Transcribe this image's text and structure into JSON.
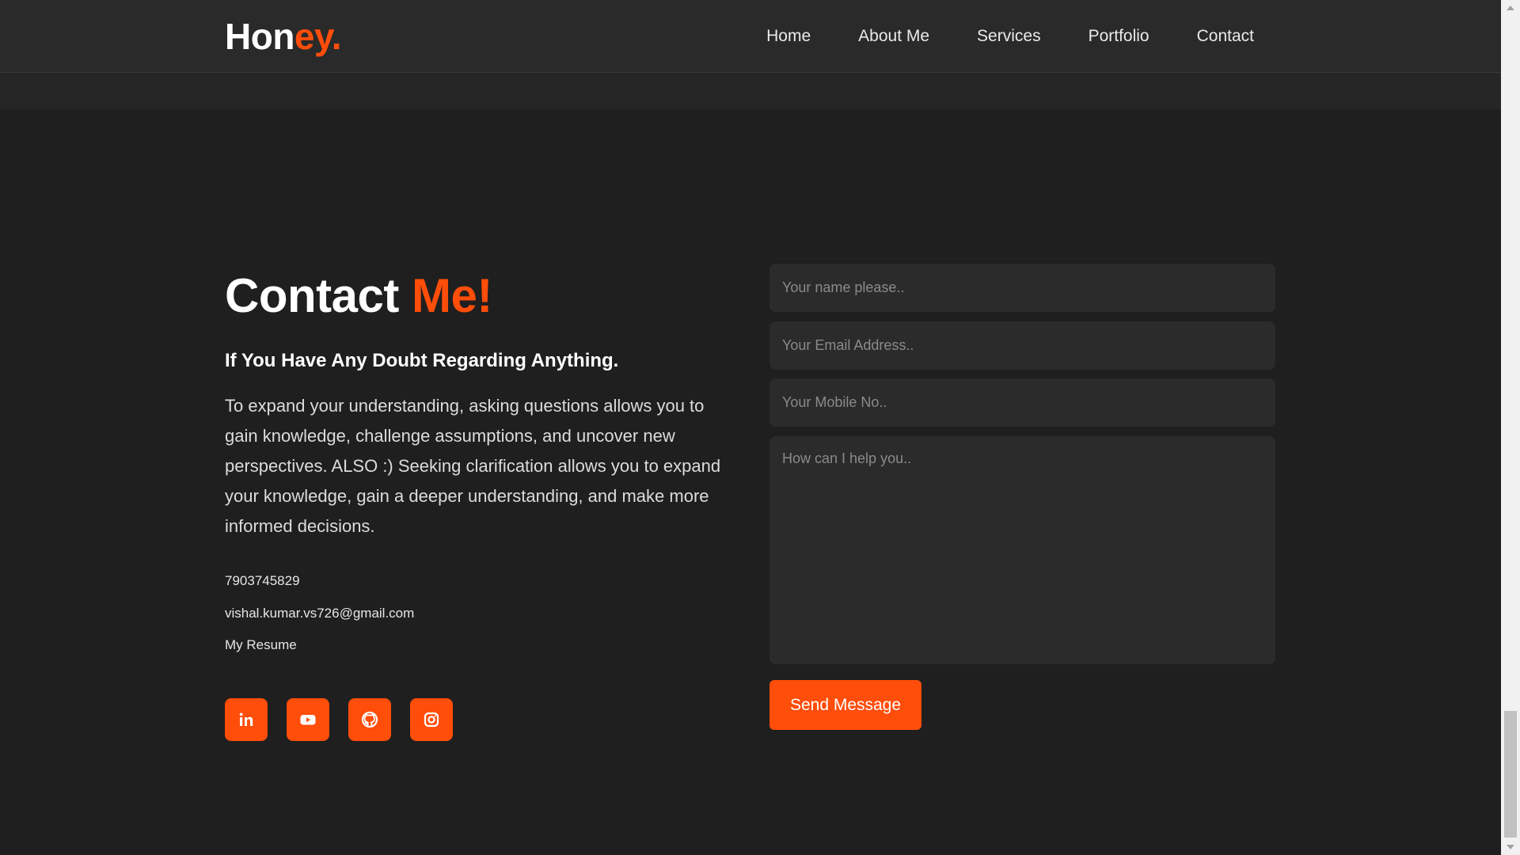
{
  "navbar": {
    "logo": {
      "part1": "Hon",
      "part2": "ey",
      "part3": "."
    },
    "links": [
      "Home",
      "About Me",
      "Services",
      "Portfolio",
      "Contact"
    ]
  },
  "contact": {
    "heading_part1": "Contact",
    "heading_part2": "Me!",
    "subheading": "If You Have Any Doubt Regarding Anything.",
    "paragraph": "To expand your understanding, asking questions allows you to gain knowledge, challenge assumptions, and uncover new perspectives. ALSO :) Seeking clarification allows you to expand your knowledge, gain a deeper understanding, and make more informed decisions.",
    "phone": "7903745829",
    "email": "vishal.kumar.vs726@gmail.com",
    "resume": "My Resume",
    "socials": [
      "linkedin-icon",
      "youtube-icon",
      "github-icon",
      "instagram-icon"
    ]
  },
  "form": {
    "name_placeholder": "Your name please..",
    "email_placeholder": "Your Email Address..",
    "mobile_placeholder": "Your Mobile No..",
    "message_placeholder": "How can I help you..",
    "submit_label": "Send Message"
  },
  "colors": {
    "accent": "#ff4d0a",
    "background": "#1f1f1f",
    "navbar": "#2a2a2a",
    "field": "#2b2b2b"
  }
}
